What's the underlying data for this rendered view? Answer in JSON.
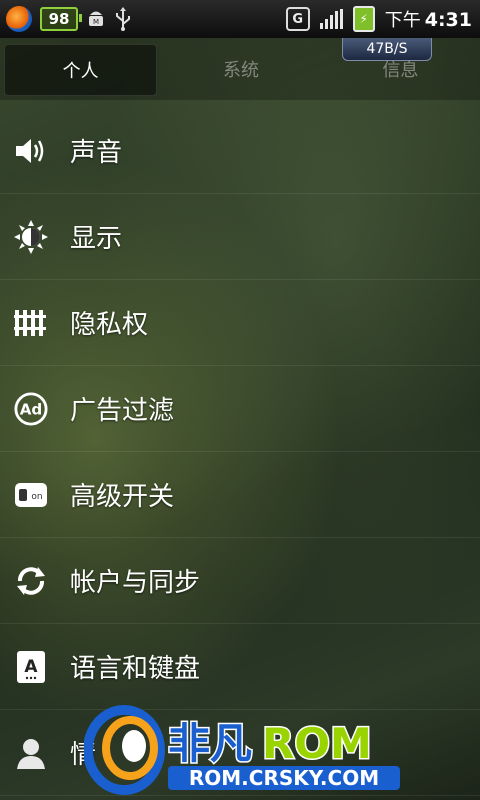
{
  "status_bar": {
    "battery_level": "98",
    "network_type": "G",
    "time_period": "下午",
    "time": "4:31",
    "icons": [
      "app-logo-icon",
      "android-debug-icon",
      "usb-icon",
      "signal-icon",
      "charging-icon"
    ]
  },
  "tabs": [
    {
      "label": "个人",
      "active": true
    },
    {
      "label": "系统",
      "active": false
    },
    {
      "label": "信息",
      "active": false
    }
  ],
  "net_speed": "47B/S",
  "settings": {
    "items": [
      {
        "label": "声音",
        "icon": "speaker-icon"
      },
      {
        "label": "显示",
        "icon": "brightness-icon"
      },
      {
        "label": "隐私权",
        "icon": "privacy-icon"
      },
      {
        "label": "广告过滤",
        "icon": "ad-filter-icon"
      },
      {
        "label": "高级开关",
        "icon": "toggle-icon"
      },
      {
        "label": "帐户与同步",
        "icon": "sync-icon"
      },
      {
        "label": "语言和键盘",
        "icon": "keyboard-icon"
      },
      {
        "label": "情",
        "icon": "person-icon"
      }
    ]
  },
  "watermark": {
    "brand_cn": "非凡",
    "brand_en": "ROM",
    "url": "ROM.CRSKY.COM"
  },
  "colors": {
    "accent_green": "#8fce3c",
    "watermark_blue": "#1a5fd0",
    "watermark_green": "#9ad400"
  }
}
